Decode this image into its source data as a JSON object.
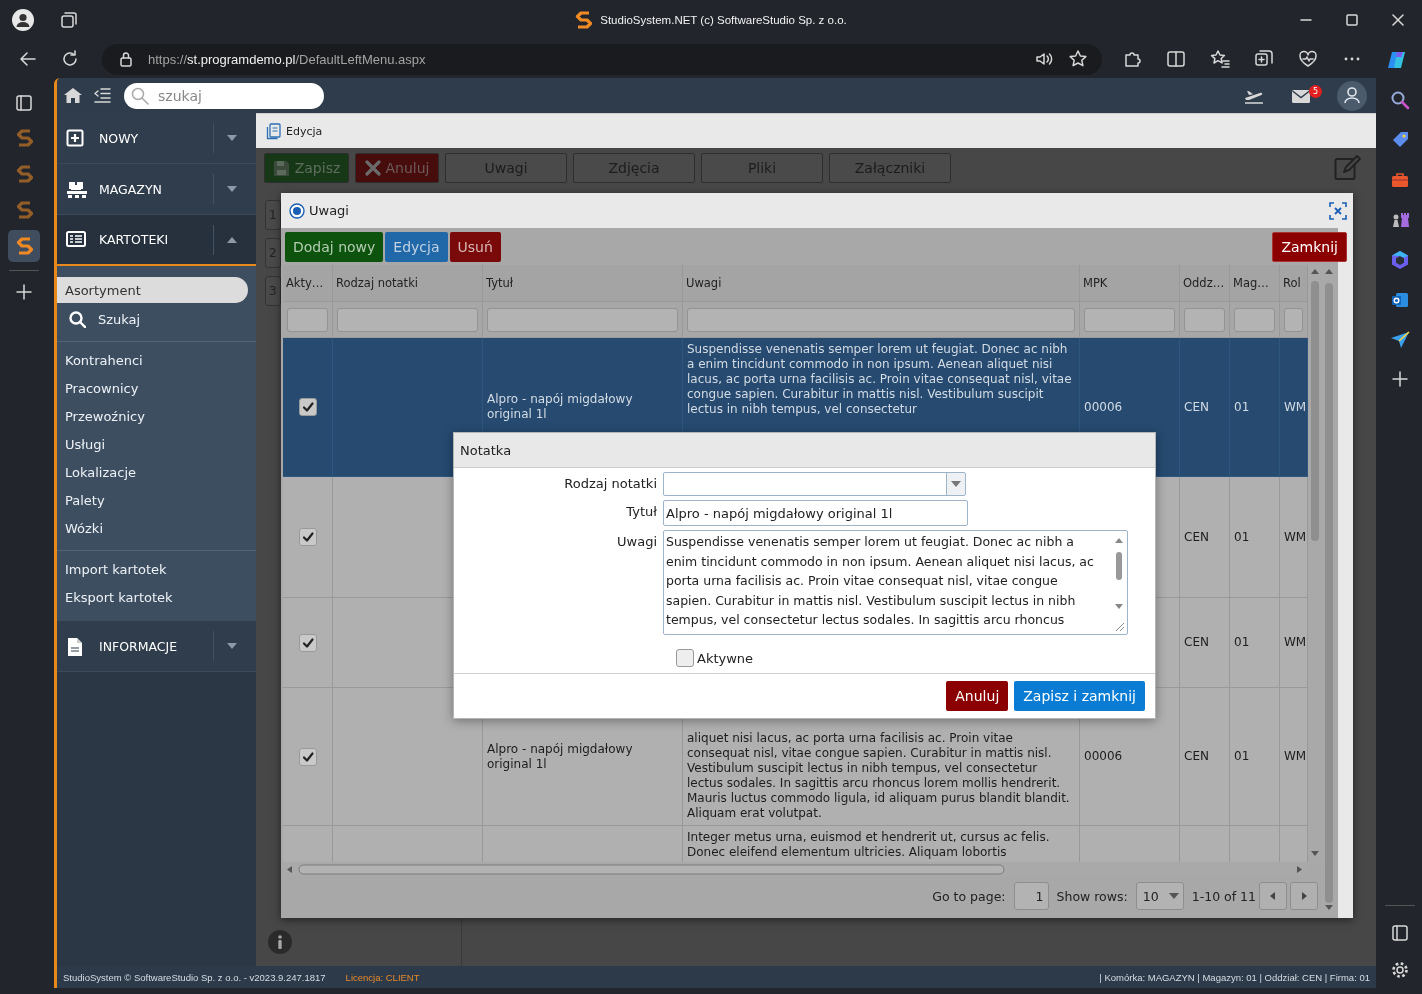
{
  "browser": {
    "title": "StudioSystem.NET (c) SoftwareStudio Sp. z o.o.",
    "url": {
      "scheme": "https://",
      "host": "st.programdemo.pl",
      "path": "/DefaultLeftMenu.aspx"
    },
    "vertical_tabs": [
      {
        "selected": false
      },
      {
        "selected": false
      },
      {
        "selected": false
      },
      {
        "selected": true
      }
    ]
  },
  "app": {
    "search": {
      "placeholder": "szukaj"
    },
    "mail_badge": "5"
  },
  "menu": [
    {
      "label": "NOWY",
      "kind": "new",
      "expanded": false
    },
    {
      "label": "MAGAZYN",
      "kind": "warehouse",
      "expanded": false
    },
    {
      "label": "KARTOTEKI",
      "kind": "records",
      "expanded": true,
      "groups": [
        {
          "items": [
            {
              "label": "Asortyment",
              "kind": "link",
              "selected": true
            },
            {
              "label": "Szukaj",
              "kind": "search",
              "selected": false
            }
          ]
        },
        {
          "items": [
            {
              "label": "Kontrahenci",
              "kind": "link",
              "selected": false
            },
            {
              "label": "Pracownicy",
              "kind": "link",
              "selected": false
            },
            {
              "label": "Przewoźnicy",
              "kind": "link",
              "selected": false
            },
            {
              "label": "Usługi",
              "kind": "link",
              "selected": false
            },
            {
              "label": "Lokalizacje",
              "kind": "link",
              "selected": false
            },
            {
              "label": "Palety",
              "kind": "link",
              "selected": false
            },
            {
              "label": "Wózki",
              "kind": "link",
              "selected": false
            }
          ]
        },
        {
          "items": [
            {
              "label": "Import kartotek",
              "kind": "link",
              "selected": false
            },
            {
              "label": "Eksport kartotek",
              "kind": "link",
              "selected": false
            }
          ]
        }
      ]
    },
    {
      "label": "INFORMACJE",
      "kind": "info",
      "expanded": false
    }
  ],
  "page": {
    "title": "Edycja",
    "toolbar": [
      {
        "label": "Zapisz",
        "kind": "save"
      },
      {
        "label": "Anuluj",
        "kind": "cancel"
      },
      {
        "label": "Uwagi",
        "kind": "plain"
      },
      {
        "label": "Zdjęcia",
        "kind": "plain"
      },
      {
        "label": "Pliki",
        "kind": "plain"
      },
      {
        "label": "Załączniki",
        "kind": "plain"
      }
    ],
    "row_numbers": [
      "1",
      "2",
      "3"
    ]
  },
  "notes_dialog": {
    "title": "Uwagi",
    "toolbar": [
      {
        "label": "Dodaj nowy",
        "kind": "add"
      },
      {
        "label": "Edycja",
        "kind": "edit"
      },
      {
        "label": "Usuń",
        "kind": "delete"
      }
    ],
    "close_button": "Zamknij",
    "columns": [
      "Akty…",
      "Rodzaj notatki",
      "Tytuł",
      "Uwagi",
      "MPK",
      "Oddz…",
      "Mag…",
      "Rol"
    ],
    "rows": [
      {
        "selected": true,
        "active": true,
        "title": "Alpro - napój migdałowy original 1l",
        "notes": "Suspendisse venenatis semper lorem ut feugiat. Donec ac nibh a enim tincidunt commodo in non ipsum. Aenean aliquet nisi lacus, ac porta urna facilisis ac. Proin vitae consequat nisl, vitae congue sapien. Curabitur in mattis nisl. Vestibulum suscipit lectus in nibh tempus, vel consectetur",
        "mpk": "00006",
        "branch": "CEN",
        "warehouse": "01",
        "column_8": "WM"
      },
      {
        "selected": false,
        "active": true,
        "branch": "CEN",
        "warehouse": "01",
        "column_8": "WM"
      },
      {
        "selected": false,
        "active": true,
        "branch": "CEN",
        "warehouse": "01",
        "column_8": "WM"
      },
      {
        "selected": false,
        "active": true,
        "title": "Alpro - napój migdałowy original 1l",
        "notes": "aliquet nisi lacus, ac porta urna facilisis ac. Proin vitae consequat nisl, vitae congue sapien. Curabitur in mattis nisl. Vestibulum suscipit lectus in nibh tempus, vel consectetur lectus sodales. In sagittis arcu rhoncus lorem mollis hendrerit. Mauris luctus commodo ligula, id aliquam purus blandit blandit. Aliquam erat volutpat.",
        "mpk": "00006",
        "branch": "CEN",
        "warehouse": "01",
        "column_8": "WM"
      },
      {
        "selected": false,
        "notes": "Integer metus urna, euismod et hendrerit ut, cursus ac felis. Donec eleifend elementum ultricies. Aliquam lobortis"
      }
    ],
    "pager": {
      "goto_label": "Go to page:",
      "page": "1",
      "rows_label": "Show rows:",
      "rows_value": "10",
      "range": "1-10 of 11"
    }
  },
  "note_dialog": {
    "title": "Notatka",
    "fields": [
      {
        "label": "Rodzaj notatki",
        "kind": "select"
      },
      {
        "label": "Tytuł",
        "kind": "text",
        "value": "Alpro - napój migdałowy original 1l"
      },
      {
        "label": "Uwagi",
        "kind": "textarea",
        "value": "Suspendisse venenatis semper lorem ut feugiat. Donec ac nibh a enim tincidunt commodo in non ipsum. Aenean aliquet nisi lacus, ac porta urna facilisis ac. Proin vitae consequat nisl, vitae congue sapien. Curabitur in mattis nisl. Vestibulum suscipit lectus in nibh tempus, vel consectetur lectus sodales. In sagittis arcu rhoncus"
      }
    ],
    "active": {
      "label": "Aktywne",
      "checked": false
    },
    "buttons": [
      {
        "label": "Anuluj",
        "kind": "cancel"
      },
      {
        "label": "Zapisz i zamknij",
        "kind": "primary"
      }
    ]
  },
  "status_bar": {
    "left": "StudioSystem © SoftwareStudio Sp. z o.o. - v2023.9.247.1817",
    "license": "Licencja: CLIENT",
    "right": "| Komórka: MAGAZYN | Magazyn: 01 | Oddział: CEN | Firma: 01"
  }
}
